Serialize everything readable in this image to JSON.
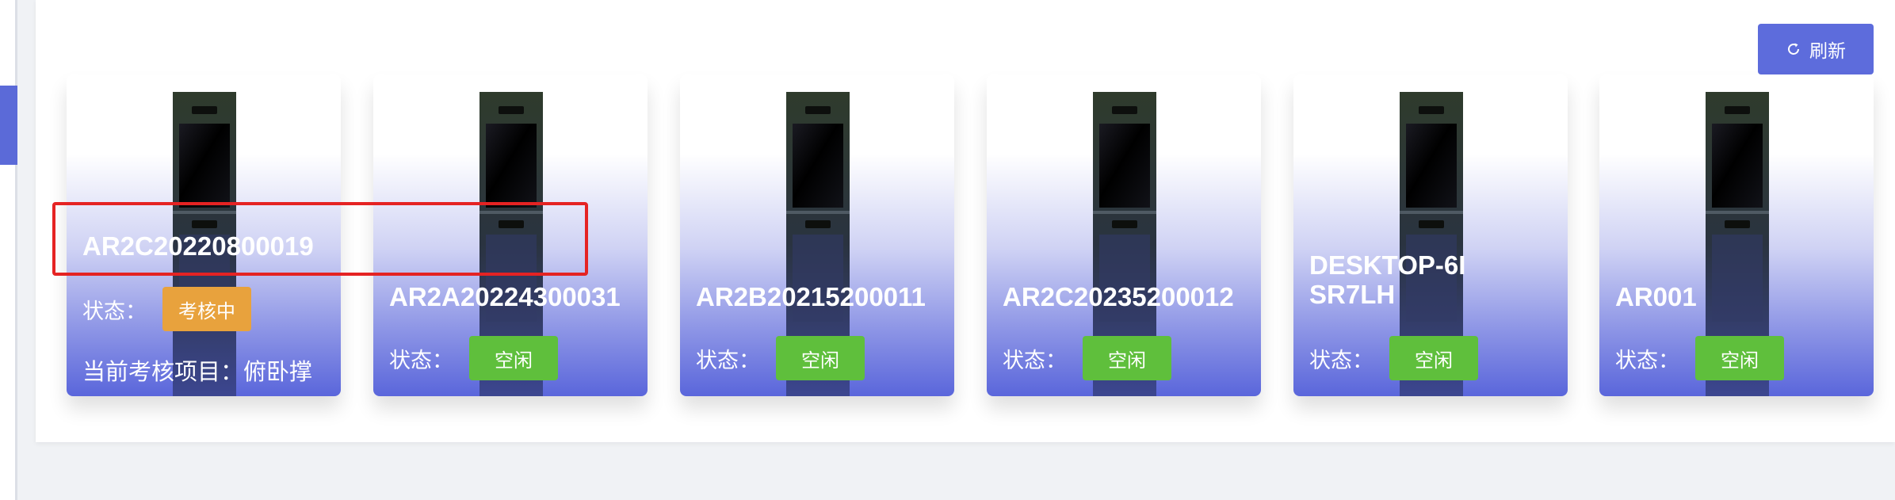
{
  "toolbar": {
    "refresh_label": "刷新",
    "refresh_icon": "refresh-icon",
    "refresh_color": "#5d6cdc"
  },
  "status_colors": {
    "assessing": "#e8a23d",
    "idle": "#5fbf3c"
  },
  "accent_color": "#5a66db",
  "highlight_color": "#e52323",
  "devices": [
    {
      "name": "AR2C20220800019",
      "status_label": "状态：",
      "status": "考核中",
      "status_type": "assessing",
      "project_label": "当前考核项目：",
      "project": "俯卧撑"
    },
    {
      "name": "AR2A20224300031",
      "status_label": "状态：",
      "status": "空闲",
      "status_type": "idle"
    },
    {
      "name": "AR2B20215200011",
      "status_label": "状态：",
      "status": "空闲",
      "status_type": "idle"
    },
    {
      "name": "AR2C20235200012",
      "status_label": "状态：",
      "status": "空闲",
      "status_type": "idle"
    },
    {
      "name": "DESKTOP-6ISR7LH",
      "status_label": "状态：",
      "status": "空闲",
      "status_type": "idle"
    },
    {
      "name": "AR001",
      "status_label": "状态：",
      "status": "空闲",
      "status_type": "idle"
    }
  ]
}
